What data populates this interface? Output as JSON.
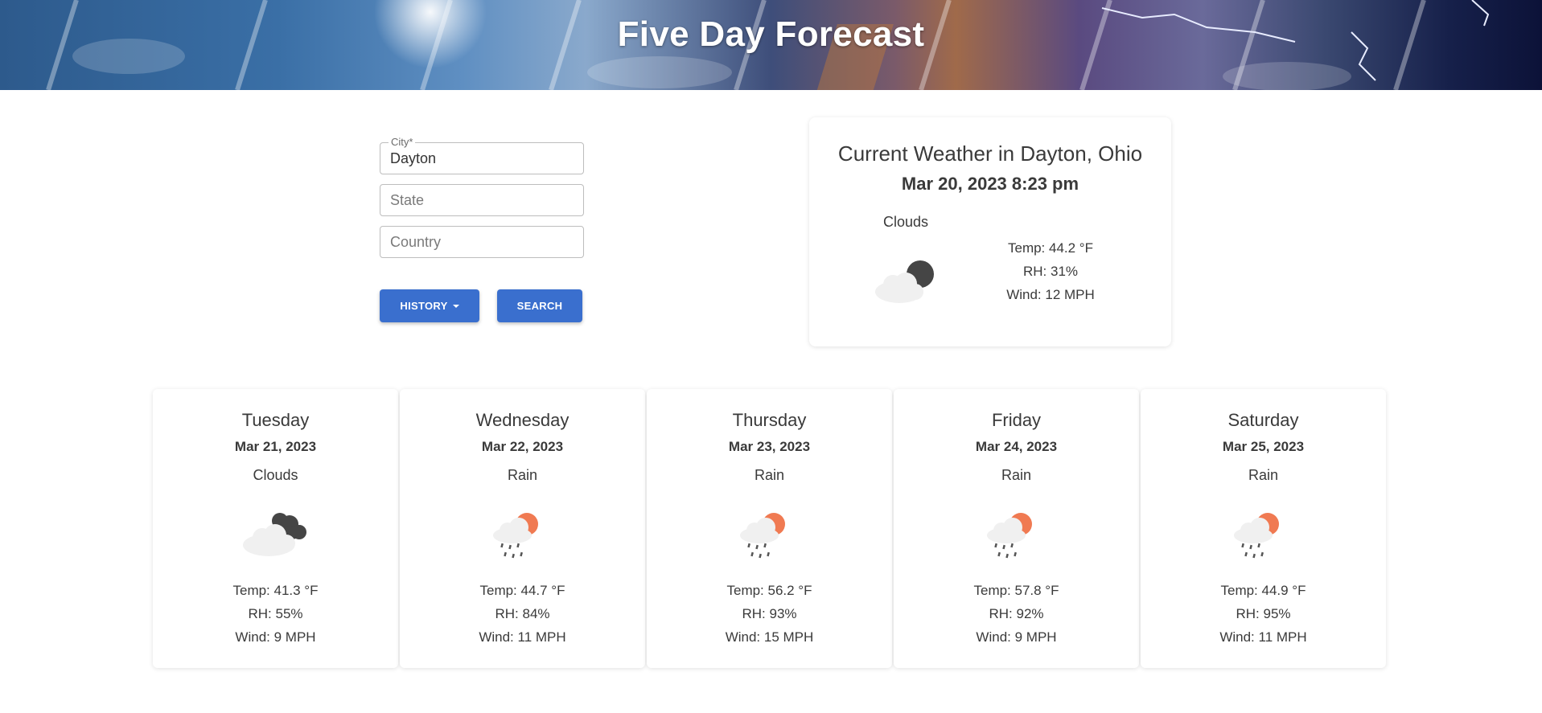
{
  "header": {
    "title": "Five Day Forecast"
  },
  "search": {
    "city": {
      "label": "City*",
      "value": "Dayton"
    },
    "state": {
      "placeholder": "State"
    },
    "country": {
      "placeholder": "Country"
    },
    "history_label": "HISTORY",
    "search_label": "SEARCH"
  },
  "current": {
    "title": "Current Weather in Dayton, Ohio",
    "datetime": "Mar 20, 2023 8:23 pm",
    "condition": "Clouds",
    "icon": "night-clouds-icon",
    "temp": "Temp: 44.2 °F",
    "rh": "RH: 31%",
    "wind": "Wind: 12 MPH"
  },
  "forecast": [
    {
      "day": "Tuesday",
      "date": "Mar 21, 2023",
      "condition": "Clouds",
      "icon": "dark-clouds-icon",
      "temp": "Temp: 41.3 °F",
      "rh": "RH: 55%",
      "wind": "Wind: 9 MPH"
    },
    {
      "day": "Wednesday",
      "date": "Mar 22, 2023",
      "condition": "Rain",
      "icon": "sun-rain-icon",
      "temp": "Temp: 44.7 °F",
      "rh": "RH: 84%",
      "wind": "Wind: 11 MPH"
    },
    {
      "day": "Thursday",
      "date": "Mar 23, 2023",
      "condition": "Rain",
      "icon": "sun-rain-icon",
      "temp": "Temp: 56.2 °F",
      "rh": "RH: 93%",
      "wind": "Wind: 15 MPH"
    },
    {
      "day": "Friday",
      "date": "Mar 24, 2023",
      "condition": "Rain",
      "icon": "sun-rain-icon",
      "temp": "Temp: 57.8 °F",
      "rh": "RH: 92%",
      "wind": "Wind: 9 MPH"
    },
    {
      "day": "Saturday",
      "date": "Mar 25, 2023",
      "condition": "Rain",
      "icon": "sun-rain-icon",
      "temp": "Temp: 44.9 °F",
      "rh": "RH: 95%",
      "wind": "Wind: 11 MPH"
    }
  ],
  "colors": {
    "button": "#3a6fce",
    "text": "#3a3a3a",
    "sun": "#f07a52",
    "cloud": "#f0f0f0",
    "dark_cloud": "#454545"
  }
}
